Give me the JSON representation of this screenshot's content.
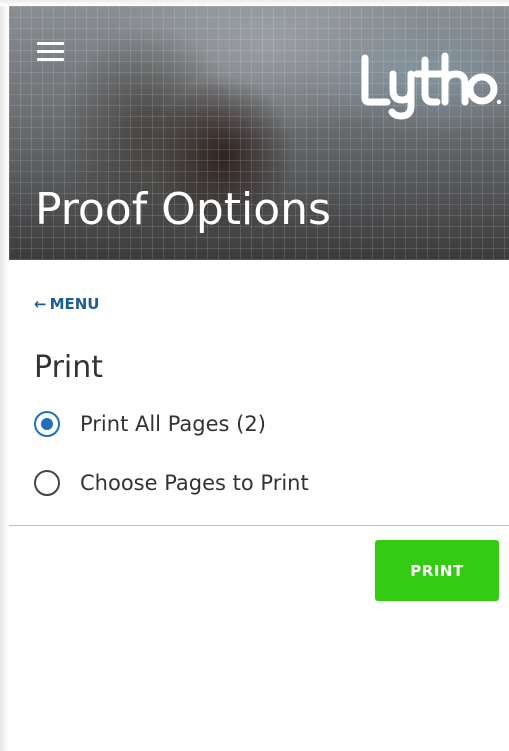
{
  "header": {
    "logo_text": "Lytho",
    "title": "Proof Options"
  },
  "nav": {
    "back_arrow": "←",
    "back_label": "MENU"
  },
  "print_section": {
    "title": "Print",
    "options": [
      {
        "label": "Print All Pages (2)",
        "selected": true
      },
      {
        "label": "Choose Pages to Print",
        "selected": false
      }
    ],
    "button_label": "PRINT"
  },
  "icons": {
    "menu": "hamburger-menu-icon",
    "back": "left-arrow-icon",
    "radio_checked": "radio-checked-icon",
    "radio_unchecked": "radio-unchecked-icon"
  },
  "colors": {
    "accent_blue": "#1f6fba",
    "link_blue": "#1f5e93",
    "print_green": "#33cc12",
    "text_dark": "#333333"
  }
}
